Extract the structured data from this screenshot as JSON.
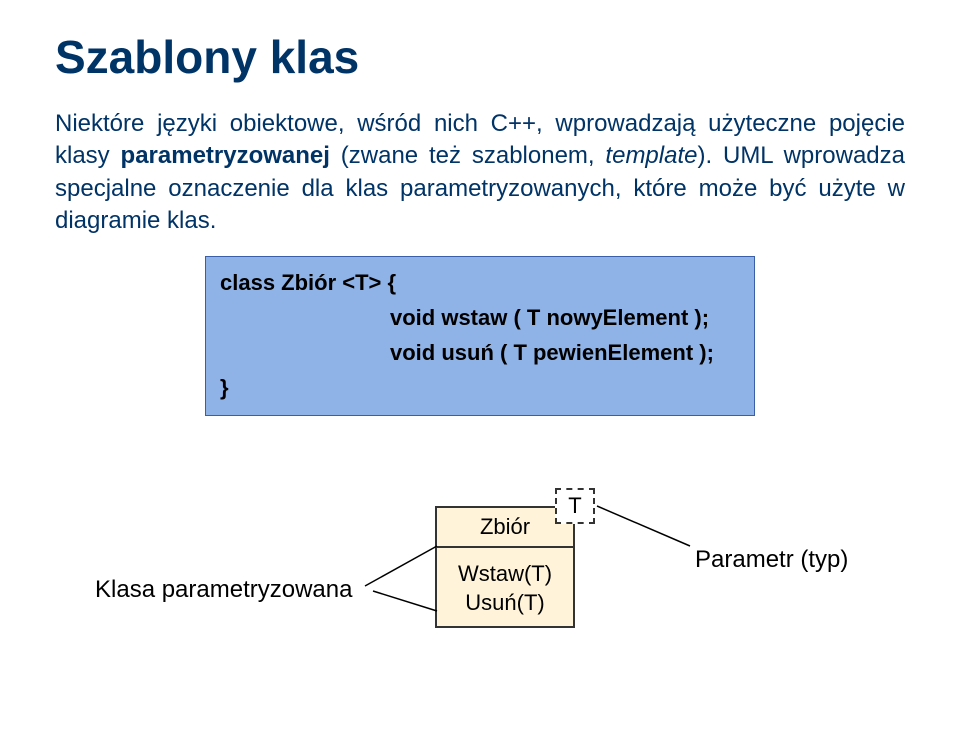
{
  "title": "Szablony klas",
  "paragraph": {
    "p1": "Niektóre języki obiektowe, wśród nich C++, wprowadzają użyteczne pojęcie klasy ",
    "p2_bold": "parametryzowanej",
    "p3": " (zwane też szablonem, ",
    "p4_italic": "template",
    "p5": "). UML wprowadza specjalne oznaczenie dla klas parametryzowanych, które może być użyte w diagramie klas."
  },
  "code": {
    "line1": "class Zbiór <T> {",
    "line2": "void wstaw ( T nowyElement );",
    "line3": "void usuń ( T pewienElement );",
    "line4": "}"
  },
  "diagram": {
    "class_name": "Zbiór",
    "method1": "Wstaw(T)",
    "method2": "Usuń(T)",
    "type_param": "T",
    "label_left": "Klasa parametryzowana",
    "label_right": "Parametr (typ)"
  }
}
